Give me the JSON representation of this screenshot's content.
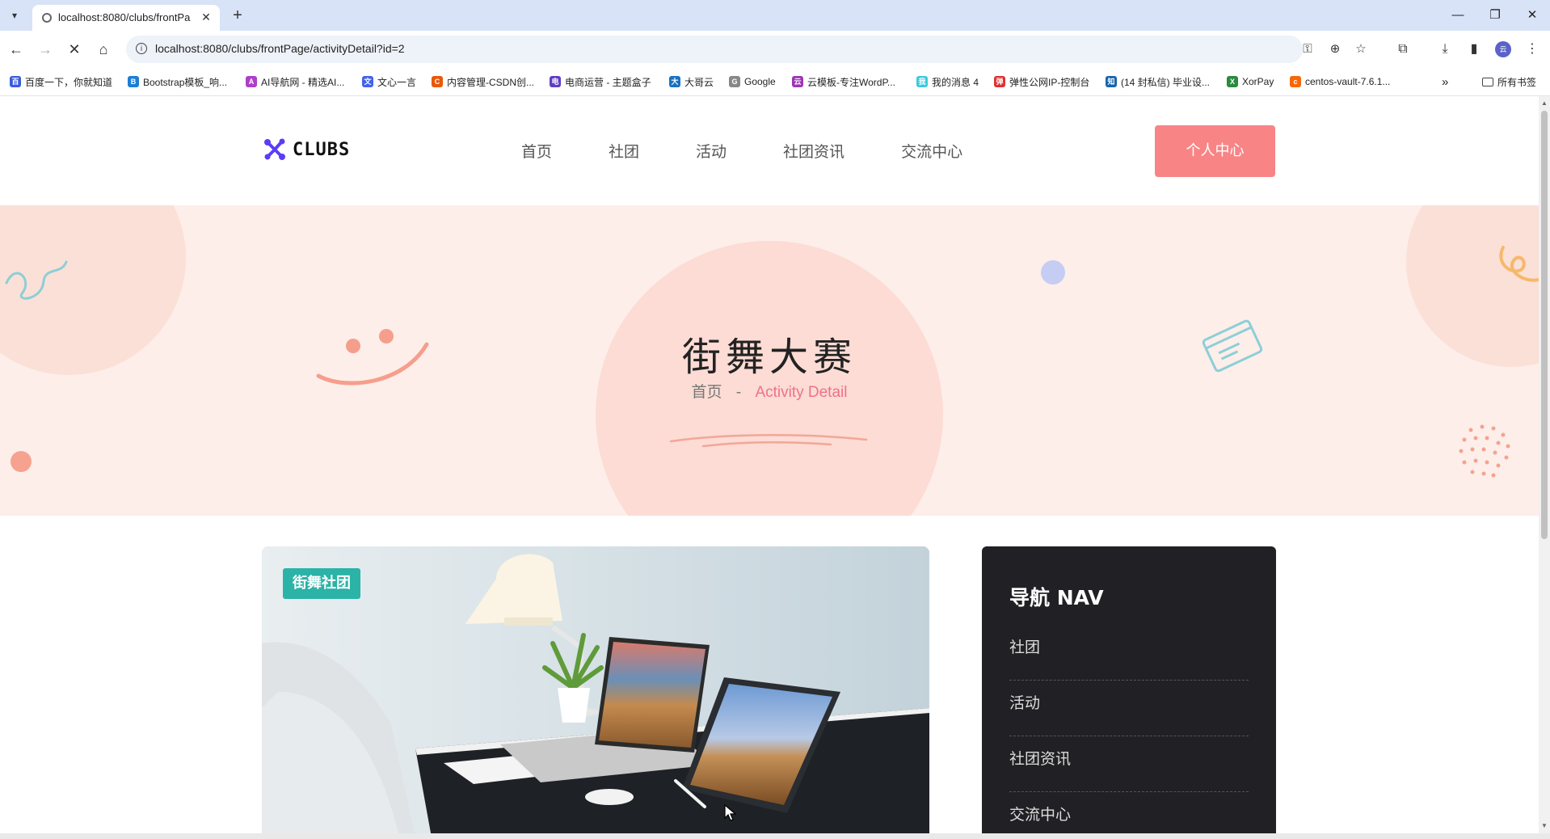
{
  "browser": {
    "tab_title": "localhost:8080/clubs/frontPa",
    "url": "localhost:8080/clubs/frontPage/activityDetail?id=2",
    "bookmarks": [
      {
        "label": "百度一下，你就知道",
        "color": "#3b5bdb",
        "glyph": "百"
      },
      {
        "label": "Bootstrap模板_响...",
        "color": "#1c7ed6",
        "glyph": "B"
      },
      {
        "label": "AI导航网 - 精选AI...",
        "color": "#ae3ec9",
        "glyph": "A"
      },
      {
        "label": "文心一言",
        "color": "#4263eb",
        "glyph": "文"
      },
      {
        "label": "内容管理-CSDN创...",
        "color": "#e8590c",
        "glyph": "C"
      },
      {
        "label": "电商运营 - 主题盒子",
        "color": "#5f3dc4",
        "glyph": "电"
      },
      {
        "label": "大哥云",
        "color": "#1971c2",
        "glyph": "大"
      },
      {
        "label": "Google",
        "color": "#888888",
        "glyph": "G"
      },
      {
        "label": "云模板-专注WordP...",
        "color": "#9c36b5",
        "glyph": "云"
      },
      {
        "label": "我的消息 4",
        "color": "#3bc9db",
        "glyph": "我"
      },
      {
        "label": "弹性公网IP-控制台",
        "color": "#e03131",
        "glyph": "弹"
      },
      {
        "label": "(14 封私信) 毕业设...",
        "color": "#1864ab",
        "glyph": "知"
      },
      {
        "label": "XorPay",
        "color": "#2b8a3e",
        "glyph": "X"
      },
      {
        "label": "centos-vault-7.6.1...",
        "color": "#f76707",
        "glyph": "c"
      }
    ],
    "all_bookmarks": "所有书签",
    "profile_initial": "云"
  },
  "site": {
    "logo_text": "CLUBS",
    "nav": [
      "首页",
      "社团",
      "活动",
      "社团资讯",
      "交流中心"
    ],
    "cta": "个人中心"
  },
  "hero": {
    "title": "街舞大赛",
    "breadcrumb_home": "首页",
    "breadcrumb_sep": "-",
    "breadcrumb_current": "Activity Detail"
  },
  "card": {
    "badge": "街舞社团"
  },
  "sidebar": {
    "title": "导航 NAV",
    "items": [
      "社团",
      "活动",
      "社团资讯",
      "交流中心"
    ]
  }
}
